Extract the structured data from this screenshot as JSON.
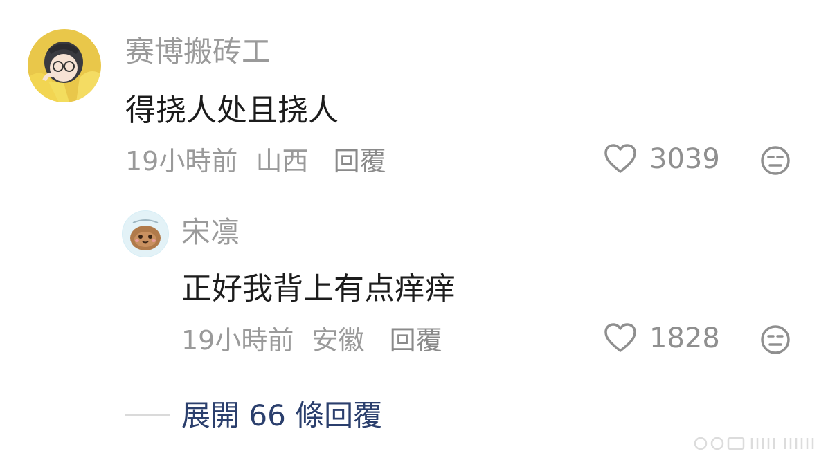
{
  "comments": [
    {
      "username": "赛博搬砖工",
      "content": "得挠人处且挠人",
      "time": "19小時前",
      "location": "山西",
      "reply_label": "回覆",
      "likes": "3039",
      "avatar_icon": "girl-yellow-raincoat-avatar"
    }
  ],
  "replies": [
    {
      "username": "宋凛",
      "content": "正好我背上有点痒痒",
      "time": "19小時前",
      "location": "安徽",
      "reply_label": "回覆",
      "likes": "1828",
      "avatar_icon": "cute-brown-creature-avatar"
    }
  ],
  "expand": {
    "label": "展開 66 條回覆"
  },
  "colors": {
    "username": "#9a9a9a",
    "content": "#1c1c1c",
    "meta": "#9a9a9a",
    "expand": "#2b3f6d"
  }
}
